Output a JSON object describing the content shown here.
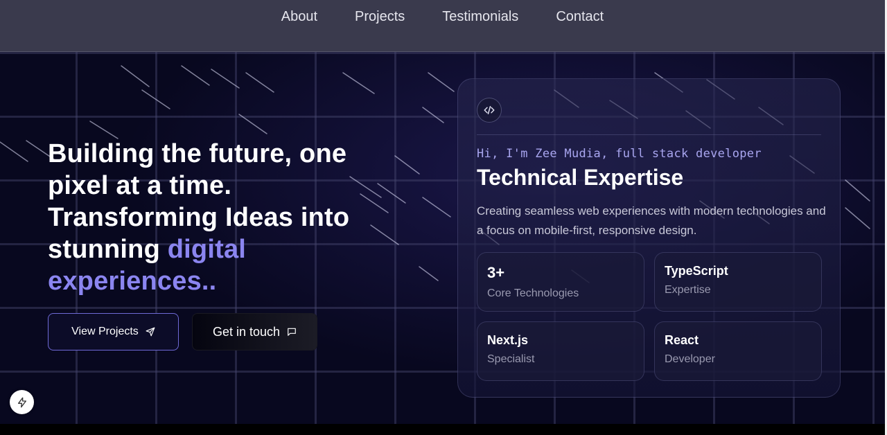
{
  "nav": {
    "links": [
      "About",
      "Projects",
      "Testimonials",
      "Contact"
    ]
  },
  "hero": {
    "title_main": "Building the future, one pixel at a time. Transforming Ideas into stunning ",
    "title_accent": "digital experiences..",
    "primary_button": "View Projects",
    "secondary_button": "Get in touch"
  },
  "card": {
    "greeting": "Hi, I'm Zee Mudia, full stack developer",
    "title": "Technical Expertise",
    "description": "Creating seamless web experiences with modern technologies and a focus on mobile-first, responsive design.",
    "stats": [
      {
        "value": "3+",
        "label": "Core Technologies"
      },
      {
        "value": "TypeScript",
        "label": "Expertise"
      },
      {
        "value": "Next.js",
        "label": "Specialist"
      },
      {
        "value": "React",
        "label": "Developer"
      }
    ]
  },
  "colors": {
    "accent": "#8b85f0",
    "background": "#08081f",
    "nav": "#3a3a4d"
  },
  "icons": {
    "card_badge": "code-icon",
    "primary_button": "send-icon",
    "secondary_button": "message-icon",
    "floating": "bolt-icon"
  }
}
